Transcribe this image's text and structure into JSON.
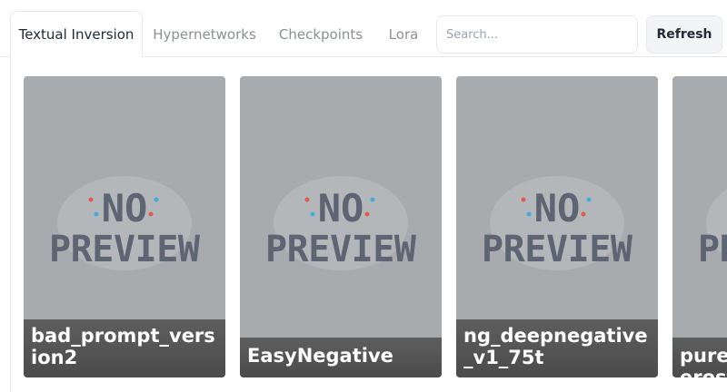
{
  "tabs": [
    {
      "label": "Textual Inversion",
      "active": true
    },
    {
      "label": "Hypernetworks",
      "active": false
    },
    {
      "label": "Checkpoints",
      "active": false
    },
    {
      "label": "Lora",
      "active": false
    }
  ],
  "search": {
    "placeholder": "Search...",
    "value": ""
  },
  "refresh_label": "Refresh",
  "preview_text": {
    "line1": "NO",
    "line2": "PREVIEW"
  },
  "cards": [
    {
      "name": "bad_prompt_version2"
    },
    {
      "name": "EasyNegative"
    },
    {
      "name": "ng_deepnegative_v1_75t"
    },
    {
      "name": "pureerosface"
    }
  ],
  "colors": {
    "card_bg": "#a8abae",
    "preview_text": "#5d6472",
    "caption_bg": "#505050",
    "accent_dots": [
      "#e05a4f",
      "#4aa8d8"
    ]
  }
}
